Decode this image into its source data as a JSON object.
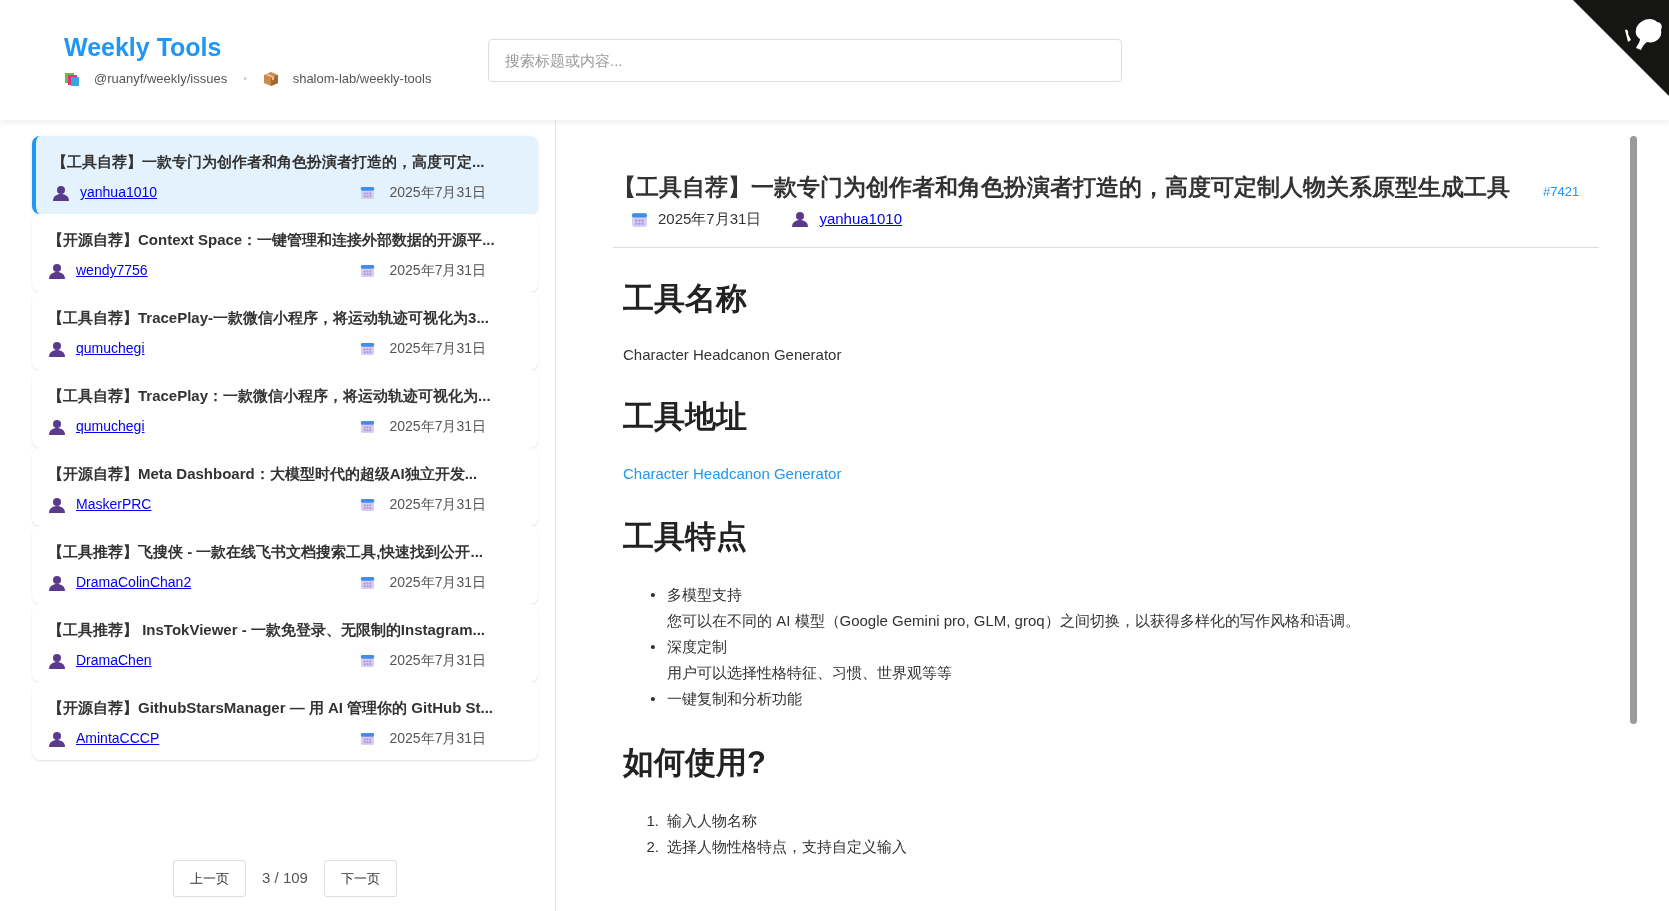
{
  "header": {
    "title": "Weekly Tools",
    "sources": [
      {
        "kind": "books",
        "label": "@ruanyf/weekly/issues"
      },
      {
        "kind": "package",
        "label": "shalom-lab/weekly-tools"
      }
    ],
    "separator": "•"
  },
  "search": {
    "placeholder": "搜索标题或内容..."
  },
  "issues": [
    {
      "title": "【工具自荐】一款专门为创作者和角色扮演者打造的，高度可定...",
      "author": "yanhua1010",
      "date": "2025年7月31日",
      "selected": true
    },
    {
      "title": "【开源自荐】Context Space：一键管理和连接外部数据的开源平...",
      "author": "wendy7756",
      "date": "2025年7月31日",
      "selected": false
    },
    {
      "title": "【工具自荐】TracePlay-一款微信小程序，将运动轨迹可视化为3...",
      "author": "qumuchegi",
      "date": "2025年7月31日",
      "selected": false
    },
    {
      "title": "【工具自荐】TracePlay：一款微信小程序，将运动轨迹可视化为...",
      "author": "qumuchegi",
      "date": "2025年7月31日",
      "selected": false
    },
    {
      "title": "【开源自荐】Meta Dashboard：大模型时代的超级AI独立开发...",
      "author": "MaskerPRC",
      "date": "2025年7月31日",
      "selected": false
    },
    {
      "title": "【工具推荐】飞搜侠 - 一款在线飞书文档搜索工具,快速找到公开...",
      "author": "DramaColinChan2",
      "date": "2025年7月31日",
      "selected": false
    },
    {
      "title": "【工具推荐】 InsTokViewer - 一款免登录、无限制的Instagram...",
      "author": "DramaChen",
      "date": "2025年7月31日",
      "selected": false
    },
    {
      "title": "【开源自荐】GithubStarsManager — 用 AI 管理你的 GitHub St...",
      "author": "AmintaCCCP",
      "date": "2025年7月31日",
      "selected": false
    }
  ],
  "pagination": {
    "prev": "上一页",
    "page": "3 / 109",
    "next": "下一页"
  },
  "detail": {
    "title": "【工具自荐】一款专门为创作者和角色扮演者打造的，高度可定制人物关系原型生成工具",
    "number": "#7421",
    "date": "2025年7月31日",
    "author": "yanhua1010",
    "content": [
      {
        "kind": "heading",
        "text": "工具名称"
      },
      {
        "kind": "paragraph",
        "text": "Character Headcanon Generator"
      },
      {
        "kind": "heading",
        "text": "工具地址"
      },
      {
        "kind": "link",
        "text": "Character Headcanon Generator"
      },
      {
        "kind": "heading",
        "text": "工具特点"
      },
      {
        "kind": "bullets",
        "items": [
          {
            "marker": "•",
            "title": "多模型支持",
            "detail": "您可以在不同的 AI 模型（Google Gemini pro, GLM, groq）之间切换，以获得多样化的写作风格和语调。"
          },
          {
            "marker": "•",
            "title": "深度定制",
            "detail": "用户可以选择性格特征、习惯、世界观等等"
          },
          {
            "marker": "•",
            "title": "一键复制和分析功能"
          }
        ]
      },
      {
        "kind": "heading",
        "text": "如何使用?"
      },
      {
        "kind": "numbered",
        "items": [
          {
            "marker": "1.",
            "title": "输入人物名称"
          },
          {
            "marker": "2.",
            "title": "选择人物性格特点，支持自定义输入"
          }
        ]
      }
    ]
  }
}
